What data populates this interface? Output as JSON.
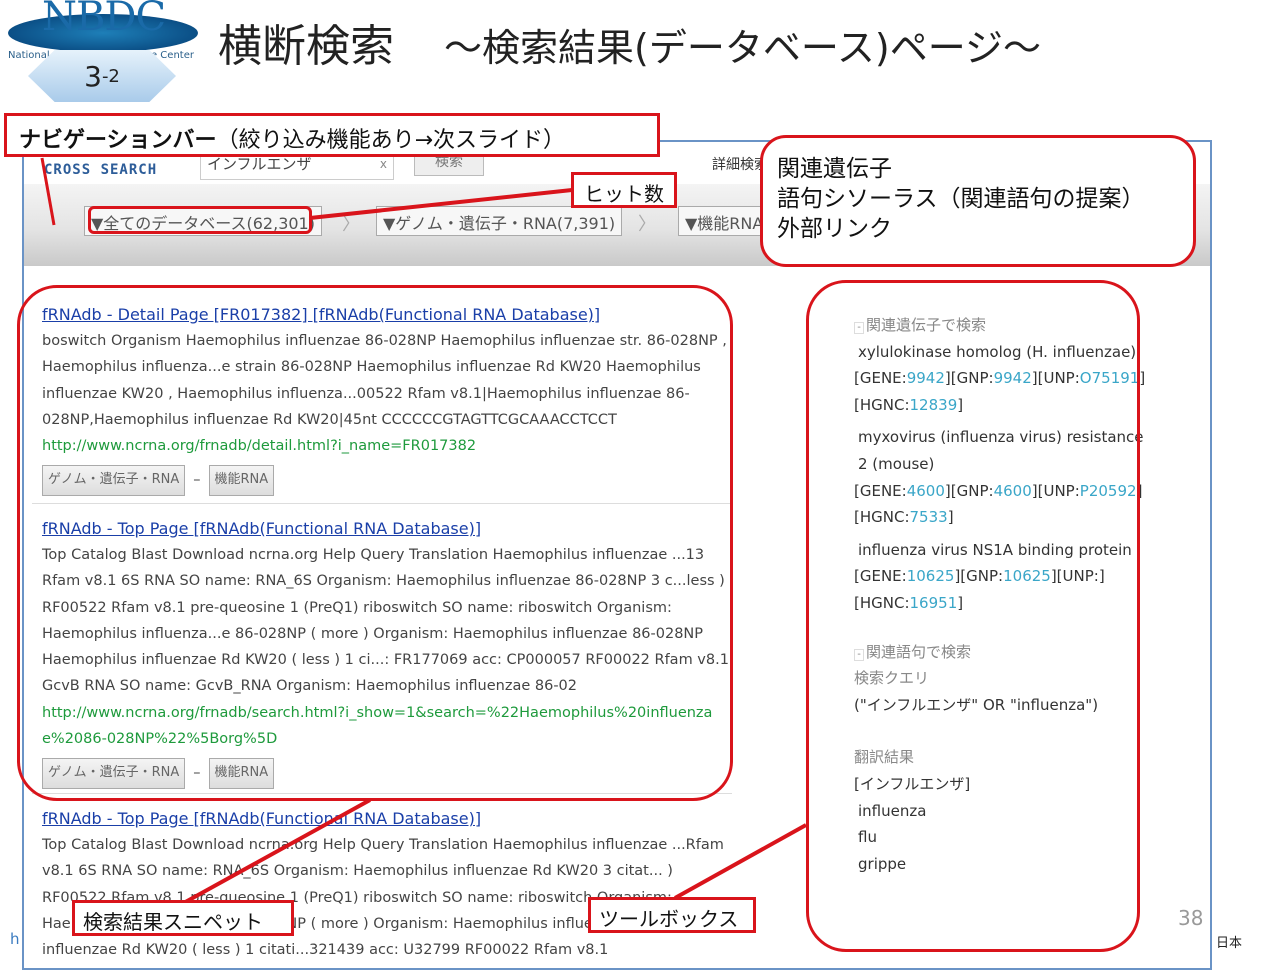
{
  "slide": {
    "logo": "NBDC",
    "logo_sub": "National Bioscience Database Center",
    "section_main": "3",
    "section_sub": "-2",
    "title": "横断検索",
    "subtitle": "～検索結果(データベース)ページ～",
    "page_number": "38",
    "footer_left": "h",
    "footer_locale": "日本"
  },
  "topbar": {
    "brand": "CROSS SEARCH",
    "search_value": "インフルエンザ",
    "clear": "x",
    "search_button": "検索",
    "advanced": "詳細検索"
  },
  "nav": {
    "crumbs": [
      "▼全てのデータベース(62,301)",
      "▼ゲノム・遺伝子・RNA(7,391)",
      "▼機能RNA"
    ],
    "separator": "〉"
  },
  "results": [
    {
      "title": "fRNAdb - Detail Page [FR017382] [fRNAdb(Functional RNA Database)]",
      "snippet": "boswitch Organism Haemophilus influenzae 86-028NP Haemophilus influenzae str. 86-028NP , Haemophilus influenza...e strain 86-028NP Haemophilus influenzae Rd KW20 Haemophilus influenzae KW20 , Haemophilus influenza...00522 Rfam v8.1|Haemophilus influenzae 86-028NP,Haemophilus influenzae Rd KW20|45nt CCCCCCGTAGTTCGCAAACCTCCT",
      "url": "http://www.ncrna.org/frnadb/detail.html?i_name=FR017382",
      "tags": [
        "ゲノム・遺伝子・RNA",
        "機能RNA"
      ],
      "tag_sep": "–"
    },
    {
      "title": "fRNAdb - Top Page [fRNAdb(Functional RNA Database)]",
      "snippet": "Top Catalog Blast Download ncrna.org Help Query Translation Haemophilus influenzae ...13 Rfam v8.1 6S RNA SO name: RNA_6S Organism: Haemophilus influenzae 86-028NP 3 c...less ) RF00522 Rfam v8.1 pre-queosine 1 (PreQ1) riboswitch SO name: riboswitch Organism: Haemophilus influenza...e 86-028NP ( more ) Organism: Haemophilus influenzae 86-028NP Haemophilus influenzae Rd KW20 ( less ) 1 ci...: FR177069 acc: CP000057 RF00022 Rfam v8.1 GcvB RNA SO name: GcvB_RNA Organism: Haemophilus influenzae 86-02",
      "url": "http://www.ncrna.org/frnadb/search.html?i_show=1&search=%22Haemophilus%20influenzae%2086-028NP%22%5Borg%5D",
      "tags": [
        "ゲノム・遺伝子・RNA",
        "機能RNA"
      ],
      "tag_sep": "–"
    },
    {
      "title": "fRNAdb - Top Page [fRNAdb(Functional RNA Database)]",
      "snippet": "Top Catalog Blast Download ncrna.org Help Query Translation Haemophilus influenzae ...Rfam v8.1 6S RNA SO name: RNA_6S Organism: Haemophilus influenzae Rd KW20 3 citat... ) RF00522 Rfam v8.1 pre-queosine 1 (PreQ1) riboswitch SO name: riboswitch Organism: Haemophilus influenza...e 86-028NP ( more ) Organism: Haemophilus influenzae Haemophilus influenzae Rd KW20 ( less ) 1 citati...321439 acc: U32799 RF00022 Rfam v8.1"
    }
  ],
  "toolbox": {
    "genes_header": "関連遺伝子で検索",
    "genes": [
      {
        "name": "xylulokinase homolog (H. influenzae)",
        "gene": "9942",
        "gnp": "9942",
        "unp": "O75191",
        "hgnc": "12839"
      },
      {
        "name": "myxovirus (influenza virus) resistance 2 (mouse)",
        "gene": "4600",
        "gnp": "4600",
        "unp": "P20592",
        "hgnc": "7533"
      },
      {
        "name": "influenza virus NS1A binding protein",
        "gene": "10625",
        "gnp": "10625",
        "unp": "",
        "hgnc": "16951"
      }
    ],
    "labels": {
      "gene": "GENE:",
      "gnp": "GNP:",
      "unp": "UNP:",
      "hgnc": "HGNC:"
    },
    "terms_header": "関連語句で検索",
    "query_label": "検索クエリ",
    "query": "(\"インフルエンザ\" OR \"influenza\")",
    "translation_label": "翻訳結果",
    "translations": [
      "[インフルエンザ]",
      "influenza",
      "flu",
      "grippe"
    ]
  },
  "callouts": {
    "navbar_bold": "ナビゲーションバー",
    "navbar_rest": "（絞り込み機能あり→次スライド）",
    "hits": "ヒット数",
    "toolbox_desc": [
      "関連遺伝子",
      "語句シソーラス（関連語句の提案）",
      "外部リンク"
    ],
    "snippet": "検索結果スニペット",
    "toolbox": "ツールボックス"
  },
  "colors": {
    "accent_red": "#d9141b",
    "link_blue": "#1a3fa8",
    "url_green": "#1e9a3c",
    "id_link": "#3aa6c8"
  }
}
